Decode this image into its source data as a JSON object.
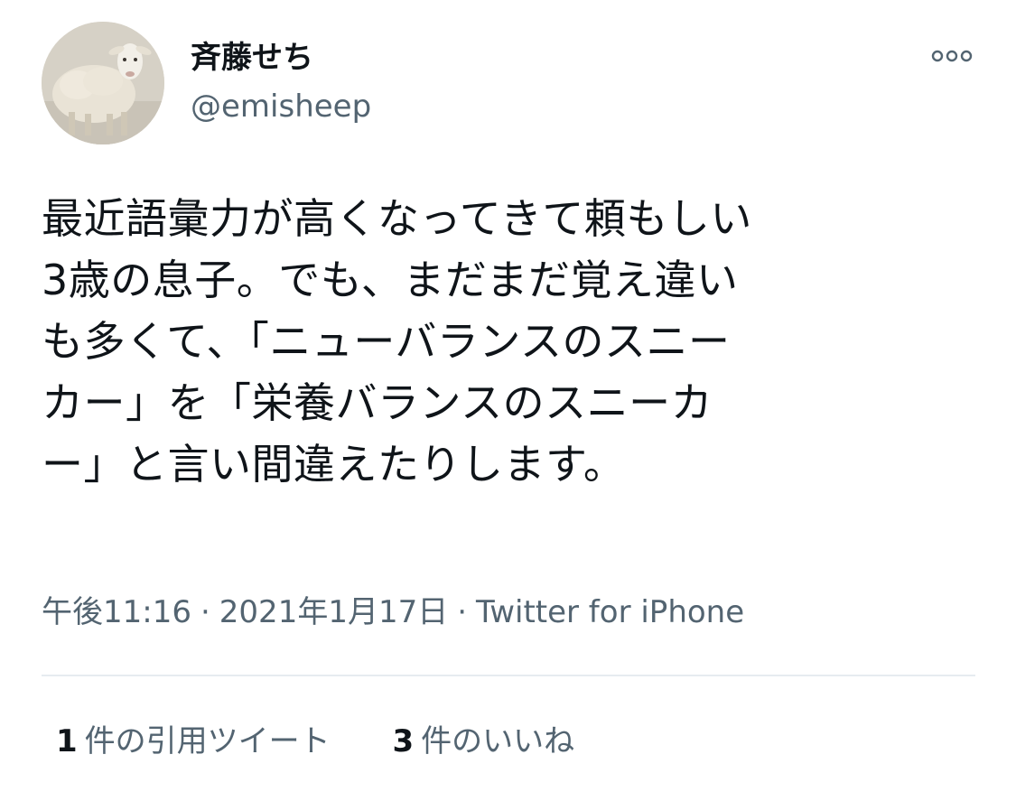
{
  "author": {
    "display_name": "斉藤せち",
    "handle": "@emisheep",
    "avatar_icon": "sheep-avatar"
  },
  "more_icon": "more-options-icon",
  "tweet": {
    "lines": [
      "最近語彙力が高くなってきて頼もしい",
      "3歳の息子。でも、まだまだ覚え違い",
      "も多くて、「ニューバランスのスニー",
      "カー」を「栄養バランスのスニーカ",
      "ー」と言い間違えたりします。"
    ]
  },
  "meta": {
    "time": "午後11:16",
    "separator": "·",
    "date": "2021年1月17日",
    "source": "Twitter for iPhone"
  },
  "stats": {
    "quotes": {
      "count": "1",
      "label": "件の引用ツイート"
    },
    "likes": {
      "count": "3",
      "label": "件のいいね"
    }
  },
  "colors": {
    "text_primary": "#0f1419",
    "text_secondary": "#536471",
    "divider": "#e6ecf0",
    "background": "#ffffff"
  }
}
